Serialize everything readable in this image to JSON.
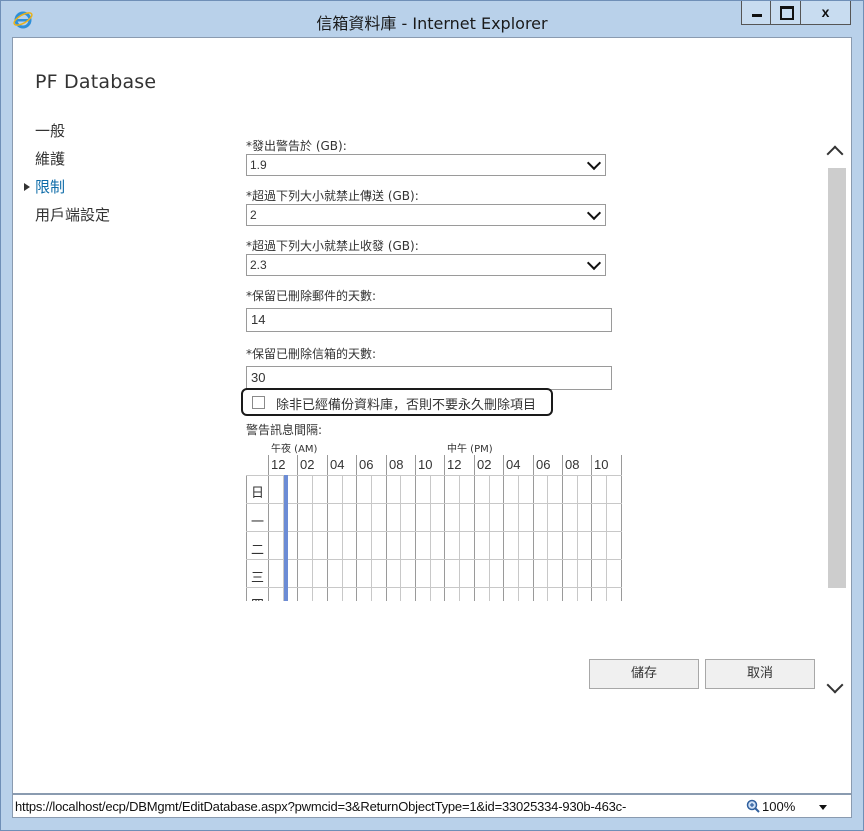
{
  "window": {
    "title": "信箱資料庫 - Internet Explorer",
    "close_label": "x"
  },
  "page": {
    "title": "PF Database"
  },
  "nav": {
    "items": [
      {
        "label": "一般",
        "active": false
      },
      {
        "label": "維護",
        "active": false
      },
      {
        "label": "限制",
        "active": true
      },
      {
        "label": "用戶端設定",
        "active": false
      }
    ]
  },
  "form": {
    "issue_warning": {
      "label": "*發出警告於 (GB):",
      "value": "1.9"
    },
    "prohibit_send": {
      "label": "*超過下列大小就禁止傳送 (GB):",
      "value": "2"
    },
    "prohibit_send_receive": {
      "label": "*超過下列大小就禁止收發 (GB):",
      "value": "2.3"
    },
    "keep_deleted_items_days": {
      "label": "*保留已刪除郵件的天數:",
      "value": "14"
    },
    "keep_deleted_mailboxes_days": {
      "label": "*保留已刪除信箱的天數:",
      "value": "30"
    },
    "checkbox_label": "除非已經備份資料庫，否則不要永久刪除項目",
    "checkbox_checked": false
  },
  "schedule": {
    "label": "警告訊息間隔:",
    "am_label": "午夜 (AM)",
    "pm_label": "中午 (PM)",
    "hours": [
      "12",
      "02",
      "04",
      "06",
      "08",
      "10",
      "12",
      "02",
      "04",
      "06",
      "08",
      "10"
    ],
    "days": [
      "日",
      "一",
      "二",
      "三",
      "四"
    ],
    "accent_color": "#6c8cd5"
  },
  "buttons": {
    "save": "儲存",
    "cancel": "取消"
  },
  "statusbar": {
    "url": "https://localhost/ecp/DBMgmt/EditDatabase.aspx?pwmcid=3&ReturnObjectType=1&id=33025334-930b-463c-",
    "zoom": "100%"
  }
}
